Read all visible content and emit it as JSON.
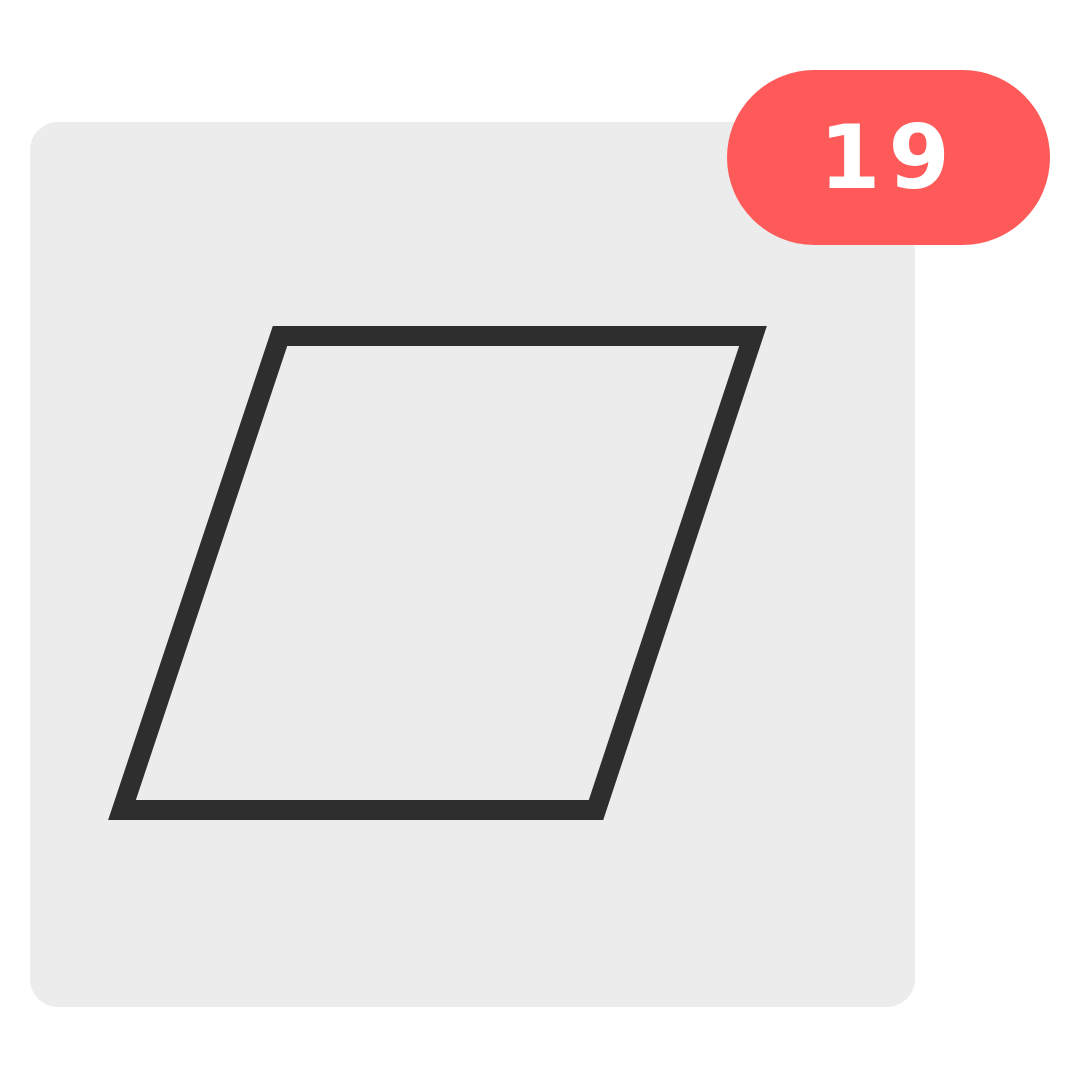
{
  "card": {
    "background_color": "#ececec",
    "shape": {
      "type": "parallelogram",
      "icon": "parallelogram-outline",
      "stroke_color": "#2e2e2e",
      "fill": "none"
    }
  },
  "badge": {
    "count": "19",
    "background_color": "#ff5a5a",
    "text_color": "#ffffff"
  }
}
